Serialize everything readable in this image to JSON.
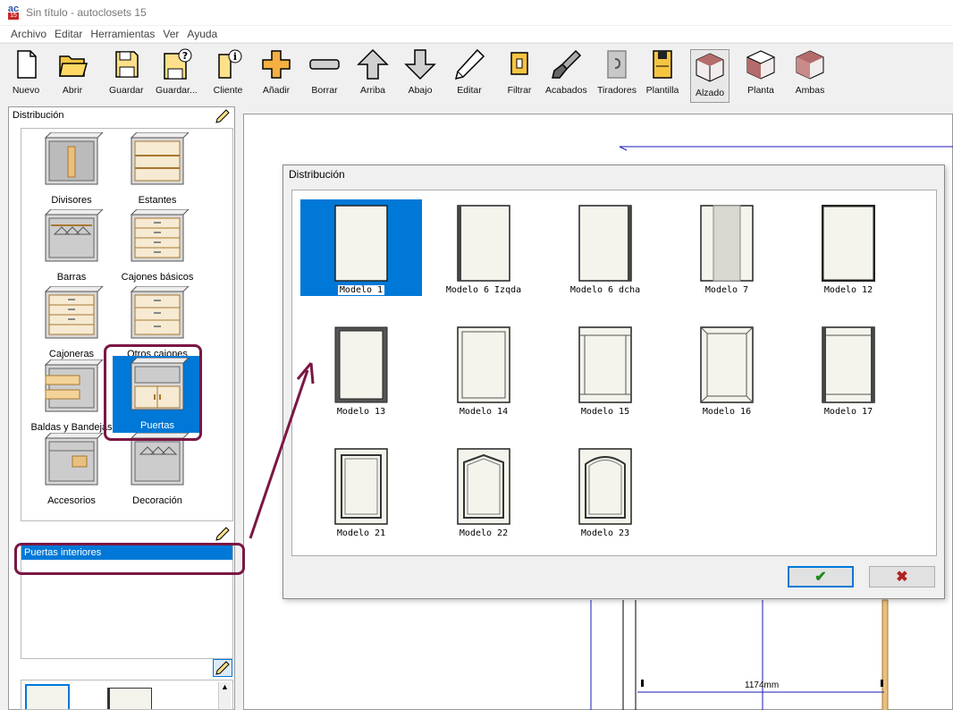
{
  "window": {
    "title": "Sin título - autoclosets 15",
    "icon_top": "ac",
    "icon_bottom": "15"
  },
  "menu": [
    "Archivo",
    "Editar",
    "Herramientas",
    "Ver",
    "Ayuda"
  ],
  "toolbar": [
    {
      "label": "Nuevo",
      "icon": "new-document-icon"
    },
    {
      "label": "Abrir",
      "icon": "open-folder-icon"
    },
    {
      "label": "Guardar",
      "icon": "save-disk-icon"
    },
    {
      "label": "Guardar...",
      "icon": "save-as-icon"
    },
    {
      "label": "Cliente",
      "icon": "client-icon"
    },
    {
      "label": "Añadir",
      "icon": "add-plus-icon"
    },
    {
      "label": "Borrar",
      "icon": "delete-minus-icon"
    },
    {
      "label": "Arriba",
      "icon": "arrow-up-icon"
    },
    {
      "label": "Abajo",
      "icon": "arrow-down-icon"
    },
    {
      "label": "Editar",
      "icon": "edit-pencil-icon"
    },
    {
      "label": "Filtrar",
      "icon": "filter-icon"
    },
    {
      "label": "Acabados",
      "icon": "finishes-brush-icon"
    },
    {
      "label": "Tiradores",
      "icon": "handles-icon"
    },
    {
      "label": "Plantilla",
      "icon": "template-icon"
    },
    {
      "label": "Alzado",
      "icon": "elevation-cube-icon",
      "active": true
    },
    {
      "label": "Planta",
      "icon": "plan-cube-icon"
    },
    {
      "label": "Ambas",
      "icon": "both-cube-icon"
    }
  ],
  "left_panel": {
    "group_title": "Distribución",
    "categories": [
      {
        "label": "Divisores"
      },
      {
        "label": "Estantes"
      },
      {
        "label": "Barras"
      },
      {
        "label": "Cajones básicos"
      },
      {
        "label": "Cajoneras"
      },
      {
        "label": "Otros cajones"
      },
      {
        "label": "Baldas y Bandejas"
      },
      {
        "label": "Puertas",
        "selected": true
      },
      {
        "label": "Accesorios"
      },
      {
        "label": "Decoración"
      }
    ],
    "sub_items": [
      {
        "label": "Puertas interiores",
        "selected": true
      }
    ]
  },
  "dialog": {
    "title": "Distribución",
    "models": [
      {
        "label": "Modelo 1",
        "selected": true
      },
      {
        "label": "Modelo 6 Izqda"
      },
      {
        "label": "Modelo 6 dcha"
      },
      {
        "label": "Modelo 7"
      },
      {
        "label": "Modelo 12"
      },
      {
        "label": "Modelo 13"
      },
      {
        "label": "Modelo 14"
      },
      {
        "label": "Modelo 15"
      },
      {
        "label": "Modelo 16"
      },
      {
        "label": "Modelo 17"
      },
      {
        "label": "Modelo 21"
      },
      {
        "label": "Modelo 22"
      },
      {
        "label": "Modelo 23"
      }
    ],
    "ok_symbol": "✔",
    "cancel_symbol": "✖"
  },
  "drawing": {
    "dimension": "1174mm"
  },
  "colors": {
    "selection": "#0078d7",
    "annotation": "#7a1744",
    "wood": "#e8c080",
    "door_fill": "#f4f4ec"
  }
}
